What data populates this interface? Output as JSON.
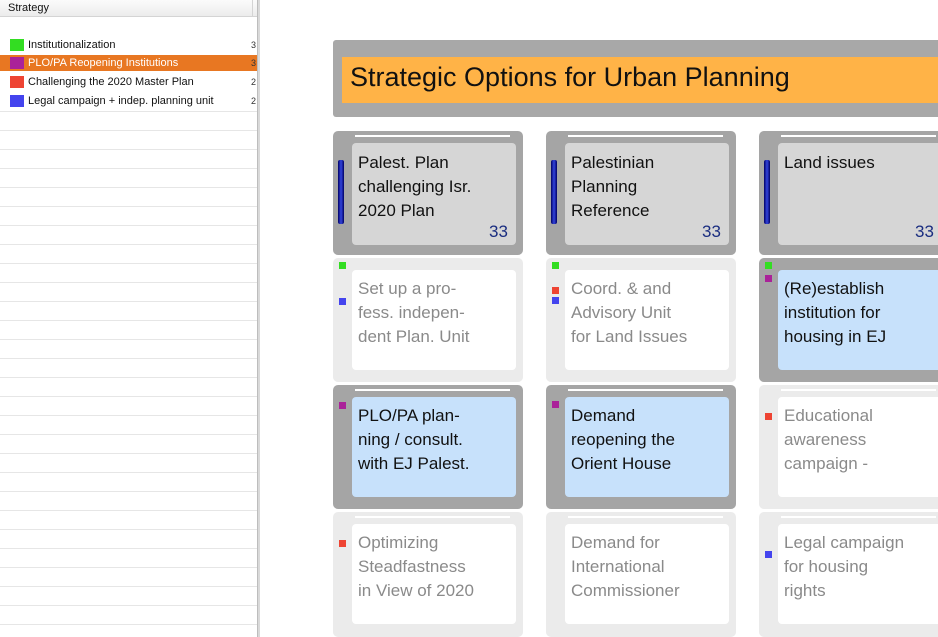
{
  "strategy_panel": {
    "header": "Strategy",
    "items": [
      {
        "label": "Institutionalization",
        "color": "#33dd22",
        "count": "3",
        "selected": false
      },
      {
        "label": "PLO/PA Reopening Institutions",
        "color": "#aa2299",
        "count": "3",
        "selected": true
      },
      {
        "label": "Challenging the 2020 Master Plan",
        "color": "#ee4433",
        "count": "2",
        "selected": false
      },
      {
        "label": "Legal campaign + indep. planning unit",
        "color": "#4444ee",
        "count": "2",
        "selected": false
      }
    ],
    "selected_color": "#e87722"
  },
  "canvas": {
    "title": "Strategic Options for Urban Planning",
    "title_color": "#ffb347",
    "headers": [
      {
        "text": "Palest. Plan\nchallenging Isr.\n2020 Plan",
        "count": "33"
      },
      {
        "text": "Palestinian\nPlanning\nReference",
        "count": "33"
      },
      {
        "text": "Land issues",
        "count": "33"
      }
    ],
    "options": [
      {
        "text": "Set up a pro-\nfess. indepen-\ndent Plan. Unit",
        "markers": [
          "green",
          "blue"
        ]
      },
      {
        "text": "Coord. & and\nAdvisory Unit\nfor Land Issues",
        "markers": [
          "green",
          "red",
          "blue"
        ]
      },
      {
        "text": "(Re)establish\ninstitution for\nhousing in EJ",
        "markers": [
          "green",
          "purple"
        ]
      },
      {
        "text": "PLO/PA plan-\nning / consult.\nwith EJ Palest.",
        "markers": [
          "purple"
        ]
      },
      {
        "text": "Demand\nreopening the\nOrient House",
        "markers": [
          "purple"
        ]
      },
      {
        "text": "Educational\nawareness\ncampaign -",
        "markers": [
          "red"
        ]
      },
      {
        "text": "Optimizing\nSteadfastness\nin View of 2020",
        "markers": [
          "red"
        ]
      },
      {
        "text": "Demand for\nInternational\nCommissioner",
        "markers": []
      },
      {
        "text": "Legal campaign\nfor housing\nrights",
        "markers": [
          "blue"
        ]
      }
    ],
    "marker_colors": {
      "green": "#33dd22",
      "purple": "#aa2299",
      "red": "#ee4433",
      "blue": "#4444ee"
    }
  }
}
